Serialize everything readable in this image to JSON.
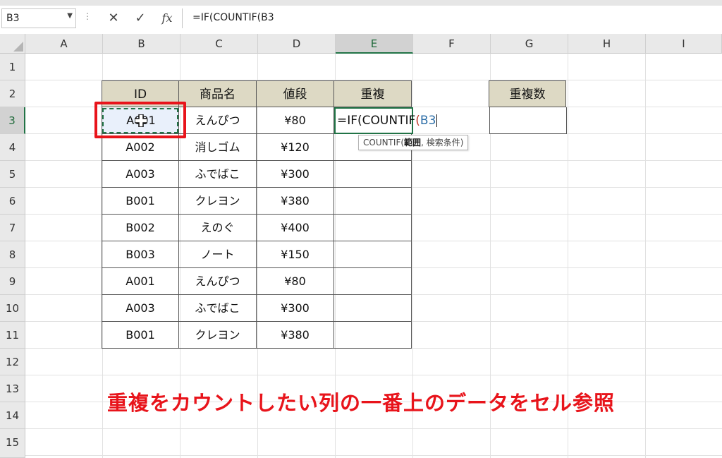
{
  "formula_bar": {
    "name_box": "B3",
    "cancel_glyph": "✕",
    "enter_glyph": "✓",
    "fx_label": "fx",
    "formula": "=IF(COUNTIF(B3"
  },
  "columns": [
    "A",
    "B",
    "C",
    "D",
    "E",
    "F",
    "G",
    "H",
    "I"
  ],
  "selected_column": "E",
  "rows": [
    "1",
    "2",
    "3",
    "4",
    "5",
    "6",
    "7",
    "8",
    "9",
    "10",
    "11",
    "12",
    "13",
    "14",
    "15"
  ],
  "selected_row": "3",
  "table": {
    "headers": {
      "id": "ID",
      "name": "商品名",
      "price": "値段",
      "dup": "重複"
    },
    "records": [
      {
        "id": "A001",
        "name": "えんぴつ",
        "price": "¥80"
      },
      {
        "id": "A002",
        "name": "消しゴム",
        "price": "¥120"
      },
      {
        "id": "A003",
        "name": "ふでばこ",
        "price": "¥300"
      },
      {
        "id": "B001",
        "name": "クレヨン",
        "price": "¥380"
      },
      {
        "id": "B002",
        "name": "えのぐ",
        "price": "¥400"
      },
      {
        "id": "B003",
        "name": "ノート",
        "price": "¥150"
      },
      {
        "id": "A001",
        "name": "えんぴつ",
        "price": "¥80"
      },
      {
        "id": "A003",
        "name": "ふでばこ",
        "price": "¥300"
      },
      {
        "id": "B001",
        "name": "クレヨン",
        "price": "¥380"
      }
    ]
  },
  "count_header": "重複数",
  "editing_cell": {
    "prefix": "=IF(COUNTIF",
    "paren": "(",
    "ref": "B3"
  },
  "tooltip": {
    "func": "COUNTIF(",
    "arg1": "範囲",
    "rest": ", 検索条件)"
  },
  "annotation": "重複をカウントしたい列の一番上のデータをセル参照",
  "colors": {
    "header_fill": "#ddd9c4",
    "excel_green": "#217346",
    "annotation_red": "#e8141b",
    "ref_blue": "#2e6fa8"
  }
}
